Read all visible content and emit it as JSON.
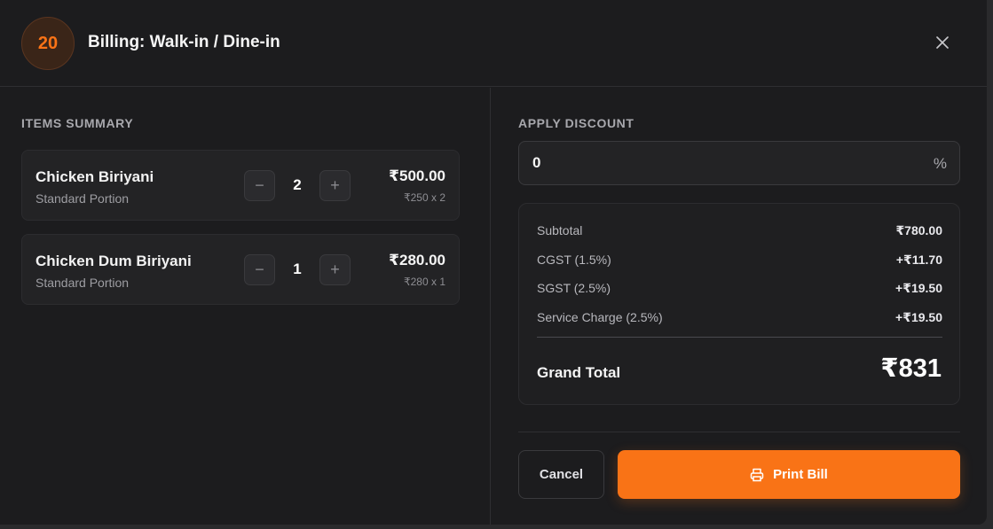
{
  "header": {
    "table_number": "20",
    "title": "Billing: Walk-in / Dine-in",
    "close_icon": "close-icon"
  },
  "items_summary": {
    "label": "ITEMS SUMMARY",
    "items": [
      {
        "name": "Chicken Biriyani",
        "portion": "Standard Portion",
        "quantity": "2",
        "total": "₹500.00",
        "calc": "₹250 x 2"
      },
      {
        "name": "Chicken Dum Biriyani",
        "portion": "Standard Portion",
        "quantity": "1",
        "total": "₹280.00",
        "calc": "₹280 x 1"
      }
    ],
    "minus_symbol": "−",
    "plus_symbol": "+"
  },
  "discount": {
    "label": "APPLY DISCOUNT",
    "value": "0",
    "unit": "%"
  },
  "summary": {
    "rows": [
      {
        "label": "Subtotal",
        "value": "₹780.00"
      },
      {
        "label": "CGST (1.5%)",
        "value": "+₹11.70"
      },
      {
        "label": "SGST (2.5%)",
        "value": "+₹19.50"
      },
      {
        "label": "Service Charge (2.5%)",
        "value": "+₹19.50"
      }
    ],
    "grand_total_label": "Grand Total",
    "grand_total_value": "₹831"
  },
  "actions": {
    "cancel_label": "Cancel",
    "print_label": "Print Bill",
    "print_icon": "printer-icon"
  },
  "colors": {
    "accent": "#f97316",
    "background": "#1c1c1e",
    "card": "#232325"
  }
}
